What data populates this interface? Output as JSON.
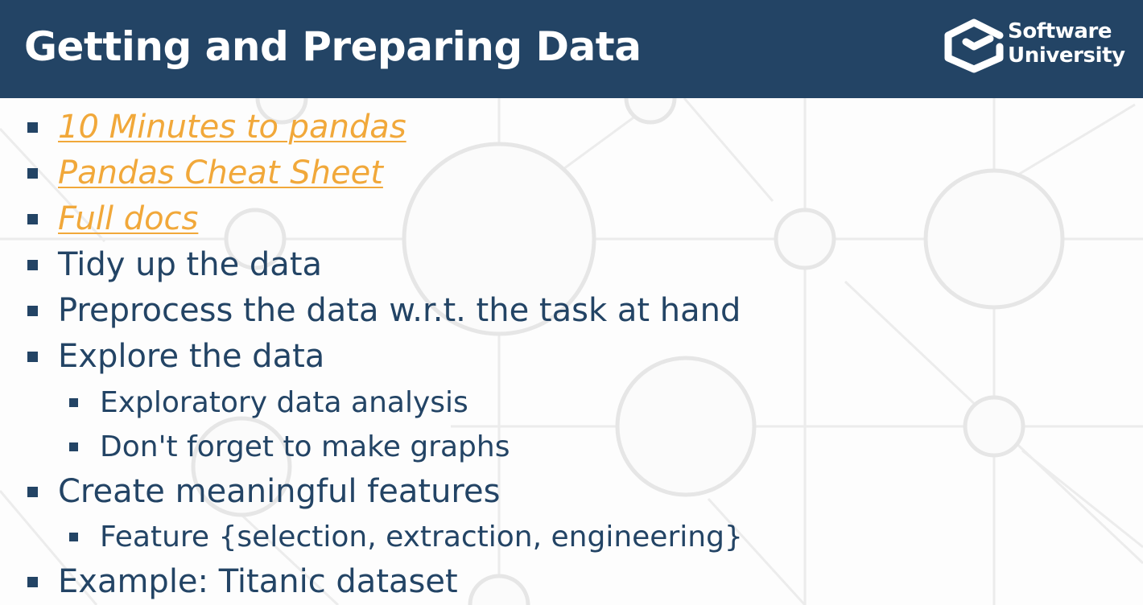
{
  "slide": {
    "title": "Getting and Preparing Data",
    "logo": {
      "line1": "Software",
      "line2": "University"
    },
    "bullets": [
      {
        "text": "10 Minutes to pandas",
        "link": true
      },
      {
        "text": "Pandas Cheat Sheet",
        "link": true
      },
      {
        "text": "Full docs",
        "link": true
      },
      {
        "text": "Tidy up the data"
      },
      {
        "text": "Preprocess the data w.r.t. the task at hand"
      },
      {
        "text": "Explore the data"
      },
      {
        "text": "Exploratory data analysis"
      },
      {
        "text": "Don't forget to make graphs"
      },
      {
        "text": "Create meaningful features"
      },
      {
        "text": "Feature {selection, extraction, engineering}"
      },
      {
        "text": "Example: Titanic dataset"
      }
    ]
  },
  "colors": {
    "header_bg": "#234465",
    "link": "#f1a83a",
    "body_text": "#234465",
    "background": "#fdfdfd"
  }
}
